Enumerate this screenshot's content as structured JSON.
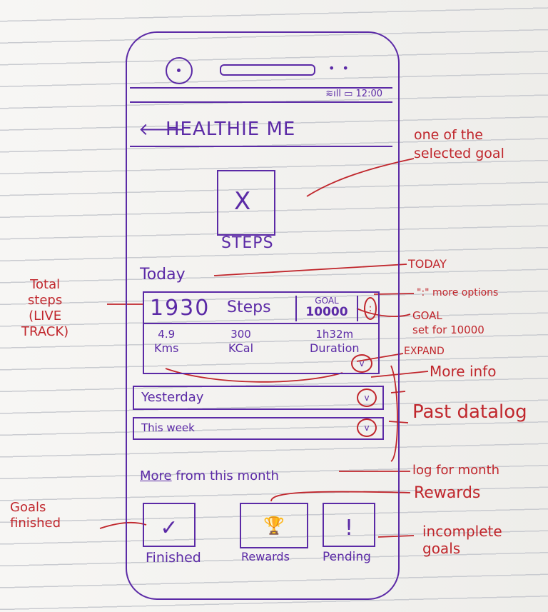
{
  "status_bar": {
    "icons": "signal-wifi-battery",
    "time": "12:00"
  },
  "app_bar": {
    "back_icon": "arrow-left",
    "title": "HEALTHIE ME"
  },
  "selected_goal": {
    "icon": "X",
    "label": "STEPS"
  },
  "today": {
    "heading": "Today",
    "steps_count": "1930",
    "steps_unit": "Steps",
    "goal_title": "GOAL",
    "goal_value": "10000",
    "more_icon": ":",
    "stats": [
      {
        "value": "4.9",
        "unit": "Kms"
      },
      {
        "value": "300",
        "unit": "KCal"
      },
      {
        "value": "1h32m",
        "unit": "Duration"
      }
    ],
    "expand_icon": "v"
  },
  "past": [
    {
      "label": "Yesterday",
      "icon": "v"
    },
    {
      "label": "This week",
      "icon": "v"
    }
  ],
  "month": {
    "link": "More",
    "rest": "from this month"
  },
  "tiles": [
    {
      "label": "Finished",
      "icon": "✓"
    },
    {
      "label": "Rewards",
      "icon": "🏆"
    },
    {
      "label": "Pending",
      "icon": "!"
    }
  ],
  "annotations": {
    "selected_goal": "one of the\nselected goal",
    "today": "TODAY",
    "more_options": "\":\" more options",
    "goal_set": "GOAL\nset for 10000",
    "expand": "EXPAND",
    "more_info": "More info",
    "past_data": "Past datalog",
    "log_month": "log for month",
    "rewards": "Rewards",
    "incomplete": "incomplete\ngoals",
    "total_steps": "Total\nsteps\n(LIVE\nTRACK)",
    "goals_finished": "Goals\nfinished"
  },
  "colors": {
    "ink": "#5b2aa6",
    "annotation": "#c0262c"
  }
}
